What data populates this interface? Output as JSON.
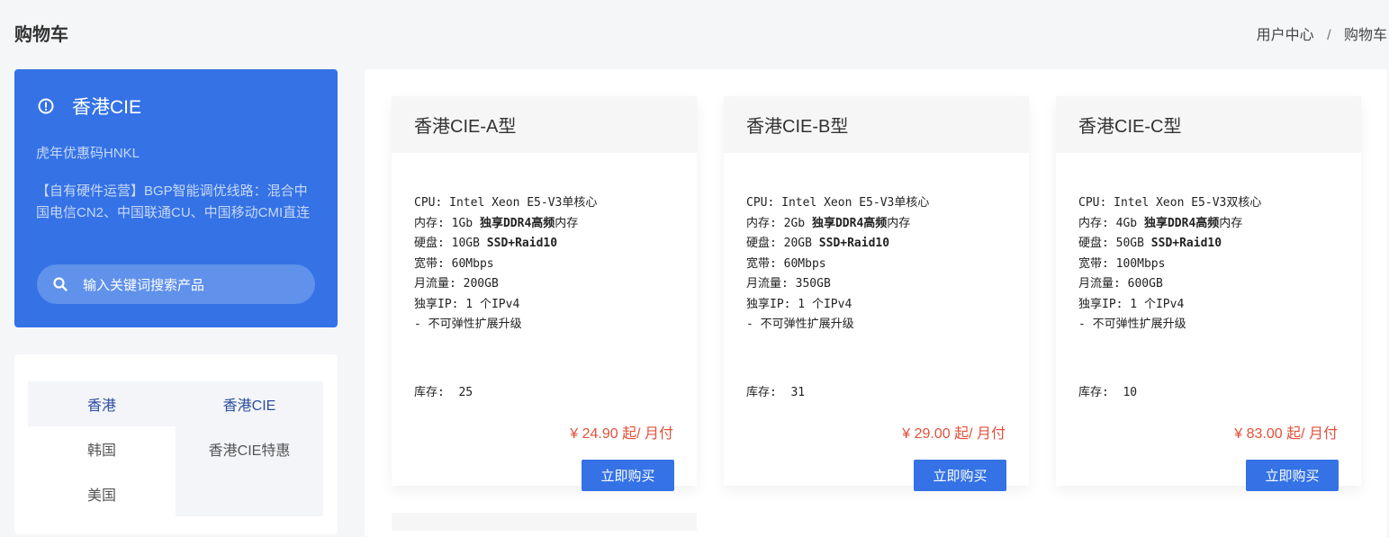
{
  "header": {
    "title": "购物车",
    "breadcrumb": [
      "用户中心",
      "/",
      "购物车"
    ]
  },
  "promo": {
    "name": "香港CIE",
    "coupon": "虎年优惠码HNKL",
    "description": "【自有硬件运营】BGP智能调优线路：混合中国电信CN2、中国联通CU、中国移动CMI直连",
    "search_placeholder": "输入关键词搜索产品"
  },
  "categories": [
    [
      "香港",
      "香港CIE"
    ],
    [
      "韩国",
      "香港CIE特惠"
    ],
    [
      "美国",
      ""
    ]
  ],
  "products": [
    {
      "name": "香港CIE-A型",
      "cpu": "CPU: Intel Xeon E5-V3单核心",
      "mem_prefix": "内存: 1Gb ",
      "mem_bold": "独享DDR4高频",
      "mem_suffix": "内存",
      "disk_prefix": "硬盘: 10GB ",
      "disk_bold": "SSD+Raid10",
      "bandwidth": "宽带: 60Mbps",
      "traffic": "月流量: 200GB",
      "ip": "独享IP: 1 个IPv4",
      "note": "- 不可弹性扩展升级",
      "stock": "库存:  25",
      "price": "¥ 24.90 起/ 月付",
      "buy": "立即购买"
    },
    {
      "name": "香港CIE-B型",
      "cpu": "CPU: Intel Xeon E5-V3单核心",
      "mem_prefix": "内存: 2Gb ",
      "mem_bold": "独享DDR4高频",
      "mem_suffix": "内存",
      "disk_prefix": "硬盘: 20GB ",
      "disk_bold": "SSD+Raid10",
      "bandwidth": "宽带: 60Mbps",
      "traffic": "月流量: 350GB",
      "ip": "独享IP: 1 个IPv4",
      "note": "- 不可弹性扩展升级",
      "stock": "库存:  31",
      "price": "¥ 29.00 起/ 月付",
      "buy": "立即购买"
    },
    {
      "name": "香港CIE-C型",
      "cpu": "CPU: Intel Xeon E5-V3双核心",
      "mem_prefix": "内存: 4Gb ",
      "mem_bold": "独享DDR4高频",
      "mem_suffix": "内存",
      "disk_prefix": "硬盘: 50GB ",
      "disk_bold": "SSD+Raid10",
      "bandwidth": "宽带: 100Mbps",
      "traffic": "月流量: 600GB",
      "ip": "独享IP: 1 个IPv4",
      "note": "- 不可弹性扩展升级",
      "stock": "库存:  10",
      "price": "¥ 83.00 起/ 月付",
      "buy": "立即购买"
    }
  ],
  "colors": {
    "accent": "#3472e6",
    "price": "#e2513a"
  }
}
